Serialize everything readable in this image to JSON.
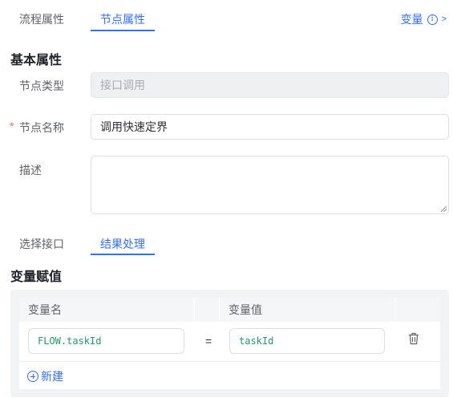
{
  "top_tabs": [
    {
      "label": "流程属性",
      "active": false
    },
    {
      "label": "节点属性",
      "active": true
    }
  ],
  "variable_link": {
    "label": "变量",
    "icon": "info-circle-icon",
    "chevron": ">"
  },
  "basic_section": {
    "title": "基本属性"
  },
  "fields": {
    "node_type": {
      "label": "节点类型",
      "value": "接口调用",
      "disabled": true
    },
    "node_name": {
      "label": "节点名称",
      "required_mark": "*",
      "value": "调用快速定界"
    },
    "description": {
      "label": "描述",
      "value": ""
    }
  },
  "sub_tabs": [
    {
      "label": "选择接口",
      "active": false
    },
    {
      "label": "结果处理",
      "active": true
    }
  ],
  "assignment_section": {
    "title": "变量赋值"
  },
  "assignment_table": {
    "columns": [
      "变量名",
      "变量值"
    ],
    "rows": [
      {
        "name": "FLOW.taskId",
        "operator": "=",
        "value": "taskId"
      }
    ],
    "add_label": "新建"
  },
  "colors": {
    "accent": "#3370ff",
    "required": "#f56c6c",
    "code_text": "#1f9c6a"
  }
}
